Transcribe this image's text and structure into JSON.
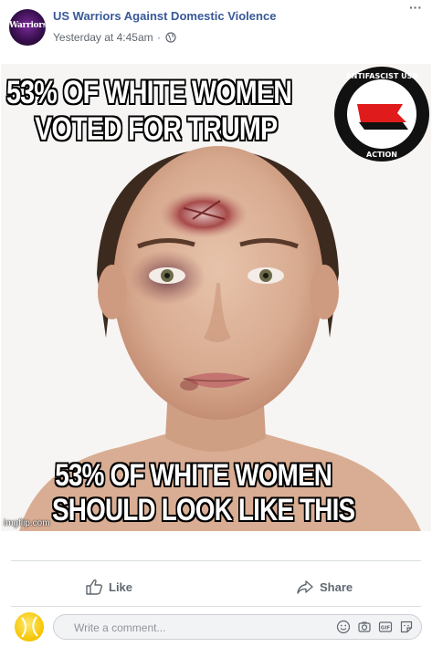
{
  "post": {
    "page_name": "US Warriors Against Domestic Violence",
    "avatar_text": "Warriors",
    "timestamp": "Yesterday at 4:45am",
    "separator": "·",
    "privacy_icon": "globe-icon",
    "more_icon": "ellipsis-icon",
    "more_label": "···"
  },
  "meme": {
    "top_line_1": "53% OF WHITE WOMEN",
    "top_line_2": "VOTED FOR TRUMP",
    "bottom_line_1": "53% OF WHITE WOMEN",
    "bottom_line_2": "SHOULD LOOK LIKE THIS",
    "watermark": "imgflip.com",
    "badge_top_text": "ANTIFASCIST USA",
    "badge_bottom_text": "ACTION"
  },
  "actions": {
    "like_label": "Like",
    "share_label": "Share"
  },
  "comment": {
    "placeholder": "Write a comment...",
    "tools": [
      "emoji-icon",
      "camera-icon",
      "gif-icon",
      "sticker-icon"
    ]
  },
  "colors": {
    "link_blue": "#385898",
    "meta_gray": "#606770",
    "divider": "#dadde1",
    "comment_bg": "#f2f3f5"
  }
}
